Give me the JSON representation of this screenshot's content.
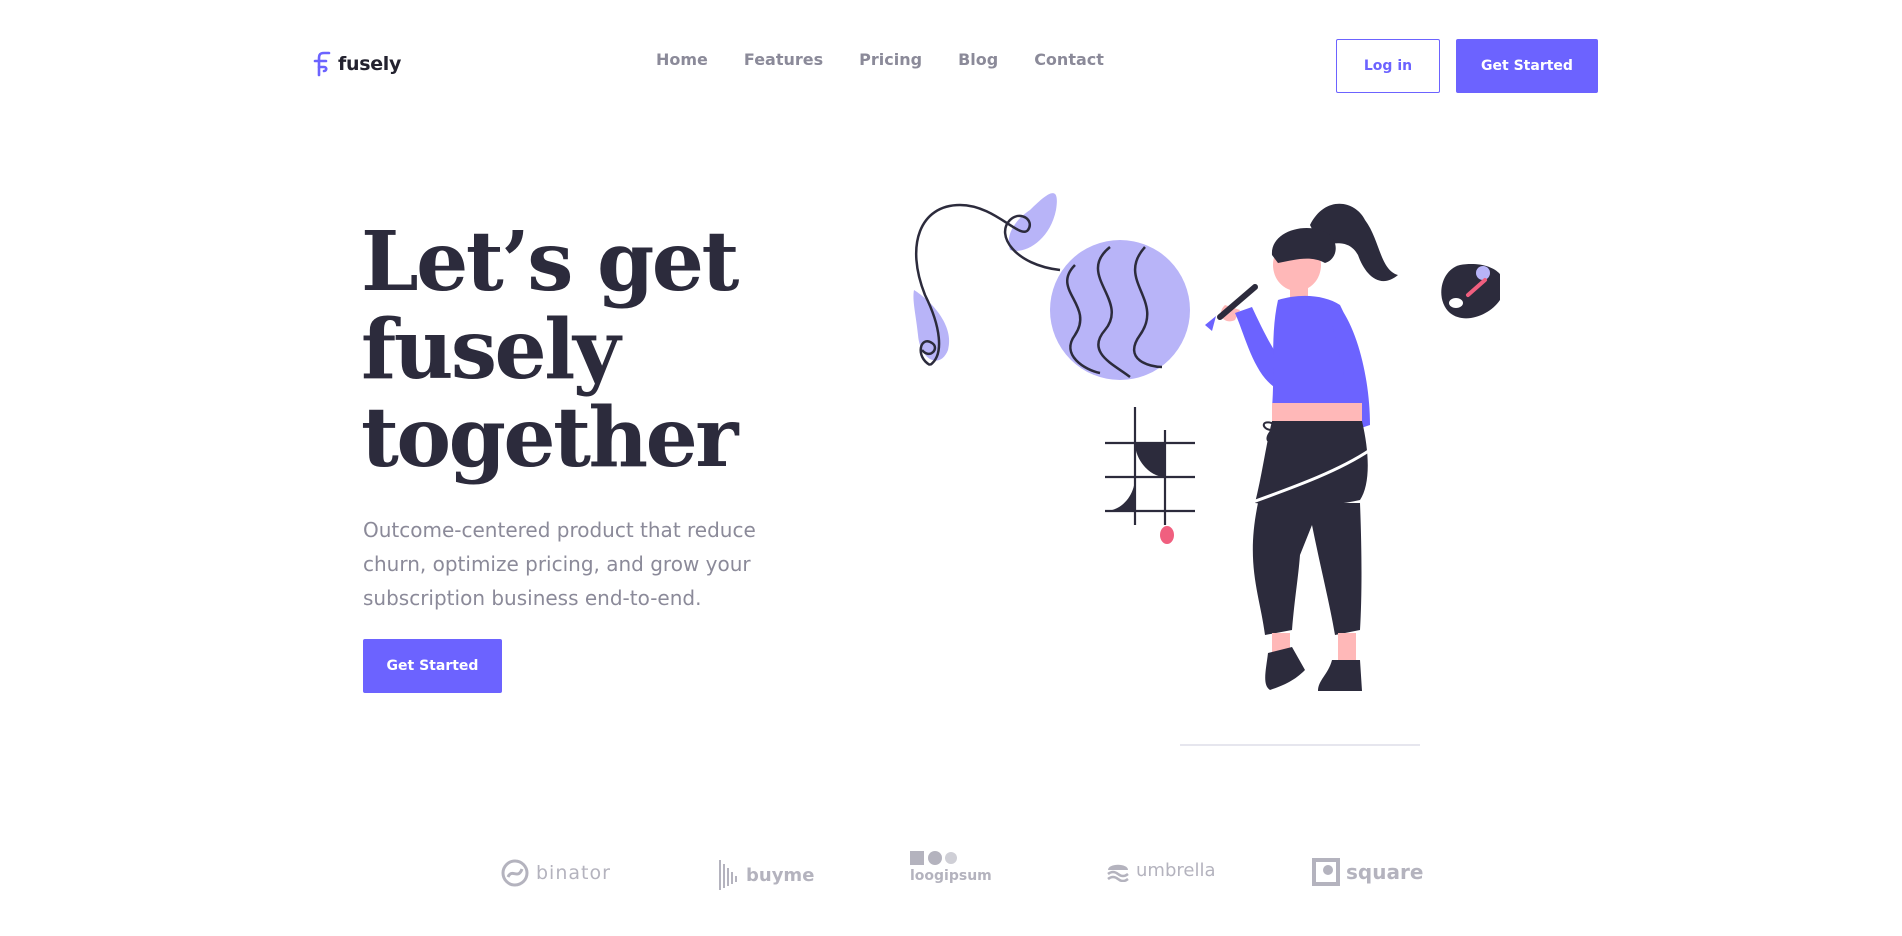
{
  "brand": {
    "name": "fusely"
  },
  "nav": {
    "items": [
      {
        "label": "Home"
      },
      {
        "label": "Features"
      },
      {
        "label": "Pricing"
      },
      {
        "label": "Blog"
      },
      {
        "label": "Contact"
      }
    ],
    "login_label": "Log in",
    "get_started_label": "Get Started"
  },
  "hero": {
    "title_lines": [
      "Let’s get",
      "fusely",
      "together"
    ],
    "subtitle": "Outcome-centered product that reduce churn, optimize pricing, and grow your subscription business end-to-end.",
    "cta_label": "Get Started"
  },
  "partners": [
    {
      "name": "binator",
      "icon": "binator-logo-icon"
    },
    {
      "name": "buyme",
      "icon": "buyme-logo-icon"
    },
    {
      "name": "loogipsum",
      "icon": "loogipsum-logo-icon"
    },
    {
      "name": "umbrella",
      "icon": "umbrella-logo-icon"
    },
    {
      "name": "square",
      "icon": "square-logo-icon"
    }
  ],
  "colors": {
    "accent": "#6c63ff",
    "accent_light": "#b8b4f8",
    "heading": "#2c2b3c",
    "muted": "#8b8a99",
    "partner_gray": "#b4b3be",
    "skin": "#ffb8b8",
    "pink": "#f05f7f"
  }
}
